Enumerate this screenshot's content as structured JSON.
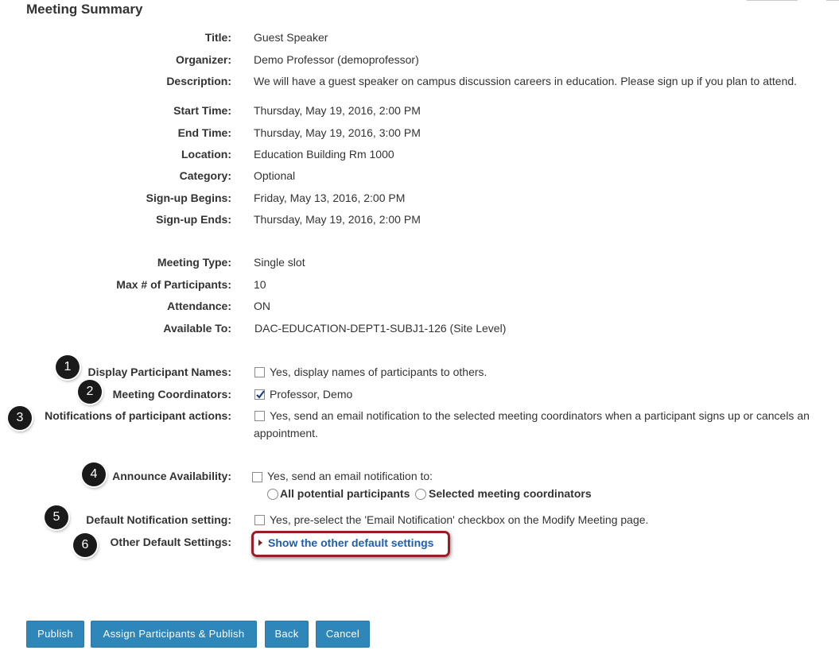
{
  "page_title": "Meeting Summary",
  "summary": {
    "title_label": "Title:",
    "title_value": "Guest Speaker",
    "organizer_label": "Organizer:",
    "organizer_value": "Demo Professor (demoprofessor)",
    "description_label": "Description:",
    "description_value": "We will have a guest speaker on campus discussion careers in education. Please sign up if you plan to attend.",
    "start_label": "Start Time:",
    "start_value": "Thursday, May 19, 2016, 2:00 PM",
    "end_label": "End Time:",
    "end_value": "Thursday, May 19, 2016, 3:00 PM",
    "location_label": "Location:",
    "location_value": "Education Building Rm 1000",
    "category_label": "Category:",
    "category_value": "Optional",
    "signup_begins_label": "Sign-up Begins:",
    "signup_begins_value": "Friday, May 13, 2016, 2:00 PM",
    "signup_ends_label": "Sign-up Ends:",
    "signup_ends_value": "Thursday, May 19, 2016, 2:00 PM",
    "meeting_type_label": "Meeting Type:",
    "meeting_type_value": "Single slot",
    "max_participants_label": "Max # of Participants:",
    "max_participants_value": "10",
    "attendance_label": "Attendance:",
    "attendance_value": "ON",
    "available_to_label": "Available To:",
    "available_to_value": "DAC-EDUCATION-DEPT1-SUBJ1-126 (Site Level)"
  },
  "options": {
    "display_names_label": "Display Participant Names:",
    "display_names_text": "Yes, display names of participants to others.",
    "display_names_checked": false,
    "coordinators_label": "Meeting Coordinators:",
    "coordinators_text": "Professor, Demo",
    "coordinators_checked": true,
    "notifications_label": "Notifications of participant actions:",
    "notifications_text_line1": "Yes, send an email notification to the selected meeting coordinators when a participant signs up or cancels an",
    "notifications_text_line2": "appointment.",
    "notifications_checked": false,
    "announce_label": "Announce Availability:",
    "announce_text": "Yes, send an email notification to:",
    "announce_checked": false,
    "radio_all": "All potential participants",
    "radio_selected": "Selected meeting coordinators",
    "default_notification_label": "Default Notification setting:",
    "default_notification_text": "Yes, pre-select the 'Email Notification' checkbox on the Modify Meeting page.",
    "default_notification_checked": false,
    "other_defaults_label": "Other Default Settings:",
    "other_defaults_link": "Show the other default settings"
  },
  "callouts": [
    "1",
    "2",
    "3",
    "4",
    "5",
    "6"
  ],
  "buttons": {
    "publish": "Publish",
    "assign_publish": "Assign Participants & Publish",
    "back": "Back",
    "cancel": "Cancel"
  },
  "colors": {
    "button_bg": "#2f86b9",
    "link": "#1f5fa9",
    "highlight_border": "#9b1c24"
  }
}
